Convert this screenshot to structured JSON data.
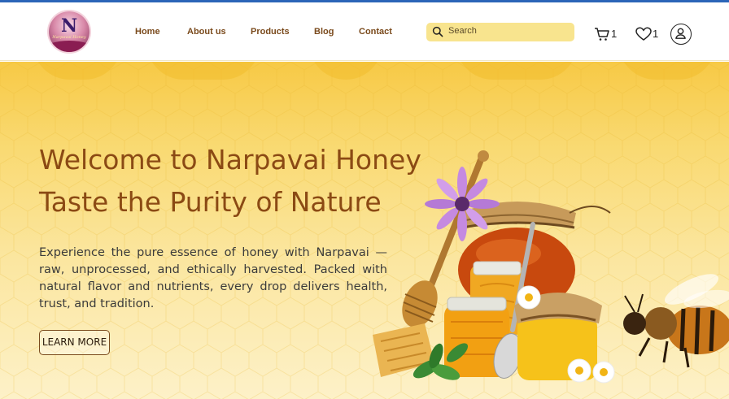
{
  "brand": {
    "logo_letter": "N",
    "logo_script": "Narpavai Honey"
  },
  "nav": {
    "items": [
      "Home",
      "About us",
      "Products",
      "Blog",
      "Contact"
    ]
  },
  "search": {
    "placeholder": "Search"
  },
  "header_icons": {
    "cart_count": "1",
    "wishlist_count": "1"
  },
  "hero": {
    "heading_line1": "Welcome to Narpavai Honey",
    "heading_line2": "Taste the Purity of Nature",
    "intro": "Experience the pure essence of honey with Narpavai — raw, unprocessed, and ethically harvested. Packed with natural flavor and nutrients, every drop delivers health, trust, and tradition.",
    "button_label": "LEARN MORE"
  },
  "colors": {
    "accent_brown": "#8b4a14",
    "search_bg": "#f8e48e",
    "hero_yellow": "#f7c945"
  }
}
